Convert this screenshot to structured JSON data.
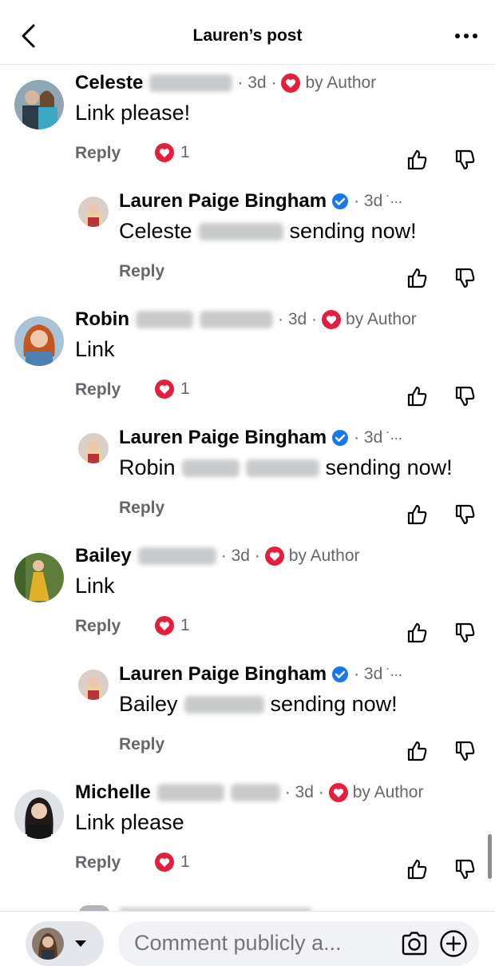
{
  "header": {
    "title": "Lauren’s post"
  },
  "labels": {
    "reply": "Reply",
    "by_author": "by Author",
    "dot": "·",
    "sending": "sending now!"
  },
  "comments": [
    {
      "first": "Celeste",
      "time": "3d",
      "text": "Link please!",
      "likes": "1",
      "reply": {
        "author": "Lauren Paige Bingham",
        "time": "3d",
        "mention": "Celeste"
      }
    },
    {
      "first": "Robin",
      "time": "3d",
      "text": "Link",
      "likes": "1",
      "reply": {
        "author": "Lauren Paige Bingham",
        "time": "3d",
        "mention": "Robin"
      }
    },
    {
      "first": "Bailey",
      "time": "3d",
      "text": "Link",
      "likes": "1",
      "reply": {
        "author": "Lauren Paige Bingham",
        "time": "3d",
        "mention": "Bailey"
      }
    },
    {
      "first": "Michelle",
      "time": "3d",
      "text": "Link please",
      "likes": "1"
    }
  ],
  "composer": {
    "placeholder": "Comment publicly a..."
  },
  "colors": {
    "heart": "#e41e3f",
    "verified": "#1877f2",
    "muted": "#65676b"
  },
  "icons": [
    "chevron-left-icon",
    "more-icon",
    "heart-icon",
    "thumb-up-icon",
    "thumb-down-icon",
    "verified-badge-icon",
    "camera-icon",
    "plus-circle-icon",
    "caret-down-icon"
  ]
}
